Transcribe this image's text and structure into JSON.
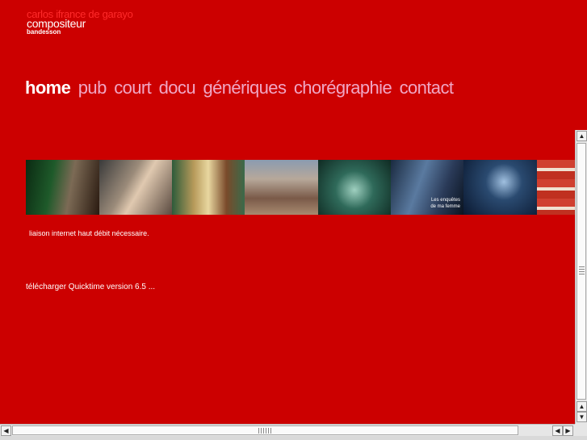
{
  "header": {
    "site_name": "carlos ifrance de garayo",
    "role": "compositeur",
    "subtitle": "bandesson"
  },
  "nav": {
    "items": [
      {
        "label": "home",
        "active": true
      },
      {
        "label": "pub",
        "active": false
      },
      {
        "label": "court",
        "active": false
      },
      {
        "label": "docu",
        "active": false
      },
      {
        "label": "génériques",
        "active": false
      },
      {
        "label": "chorégraphie",
        "active": false
      },
      {
        "label": "contact",
        "active": false
      }
    ]
  },
  "filmstrip": {
    "caption_line1": "Les enquêtes",
    "caption_line2": "de ma femme"
  },
  "notice": "liaison internet haut débit nécessaire.",
  "download_link": "télécharger Quicktime version 6.5 ...",
  "colors": {
    "background": "#cc0000",
    "nav_active": "#ffffff",
    "nav_link": "#f0a6c4"
  }
}
